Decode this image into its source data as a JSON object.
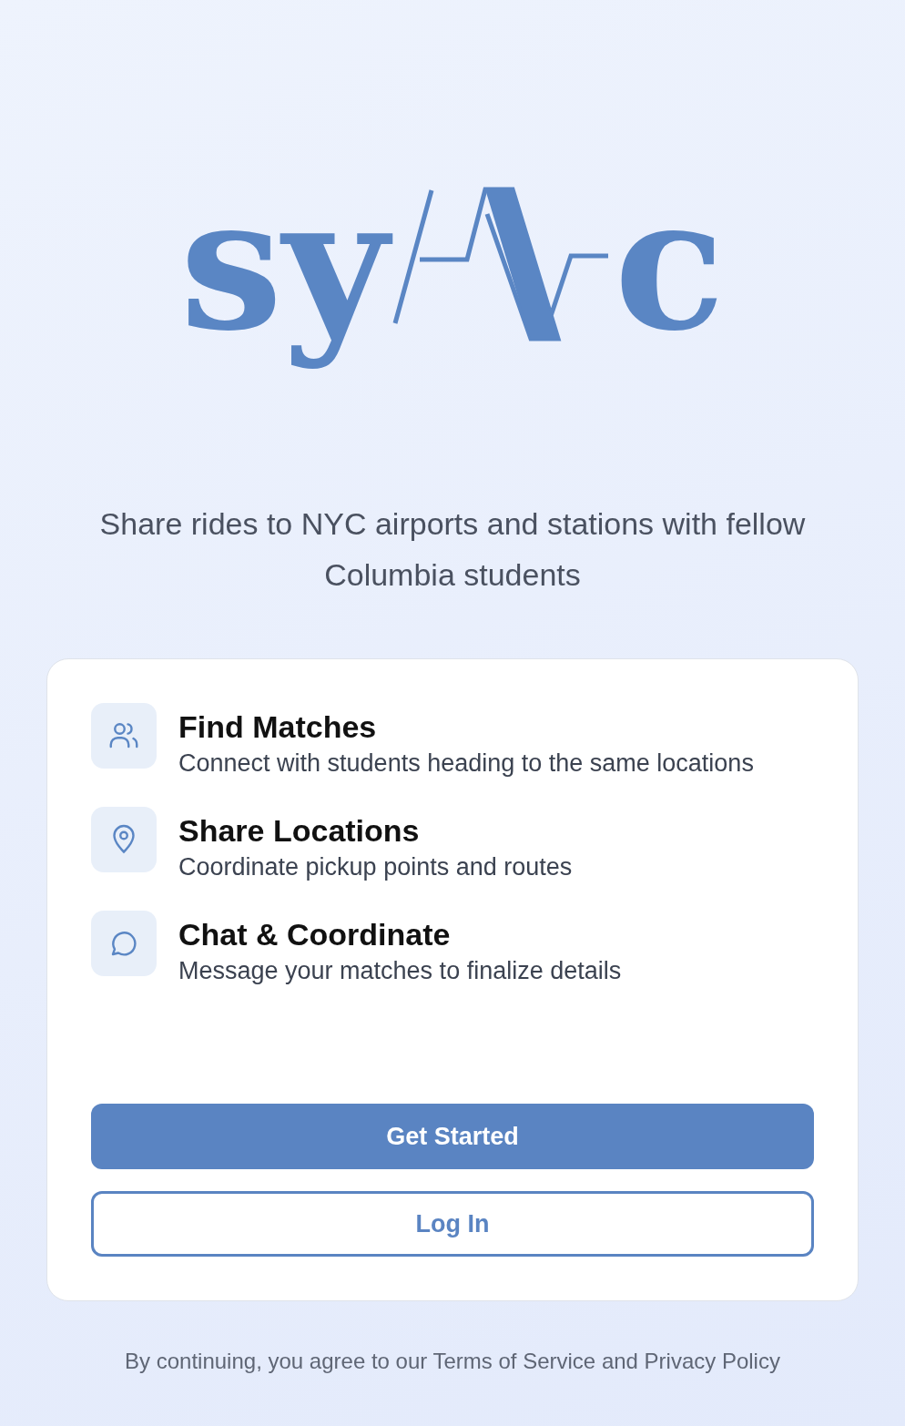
{
  "logo": {
    "before": "sy",
    "after": "c"
  },
  "tagline": "Share rides to NYC airports and stations with fellow Columbia students",
  "features": [
    {
      "kind": "people",
      "title": "Find Matches",
      "description": "Connect with students heading to the same locations"
    },
    {
      "kind": "pin",
      "title": "Share Locations",
      "description": "Coordinate pickup points and routes"
    },
    {
      "kind": "chat",
      "title": "Chat & Coordinate",
      "description": "Message your matches to finalize details"
    }
  ],
  "buttons": [
    {
      "kind": "primary",
      "label": "Get Started"
    },
    {
      "kind": "outline",
      "label": "Log In"
    }
  ],
  "footer": "By continuing, you agree to our Terms of Service and Privacy Policy"
}
